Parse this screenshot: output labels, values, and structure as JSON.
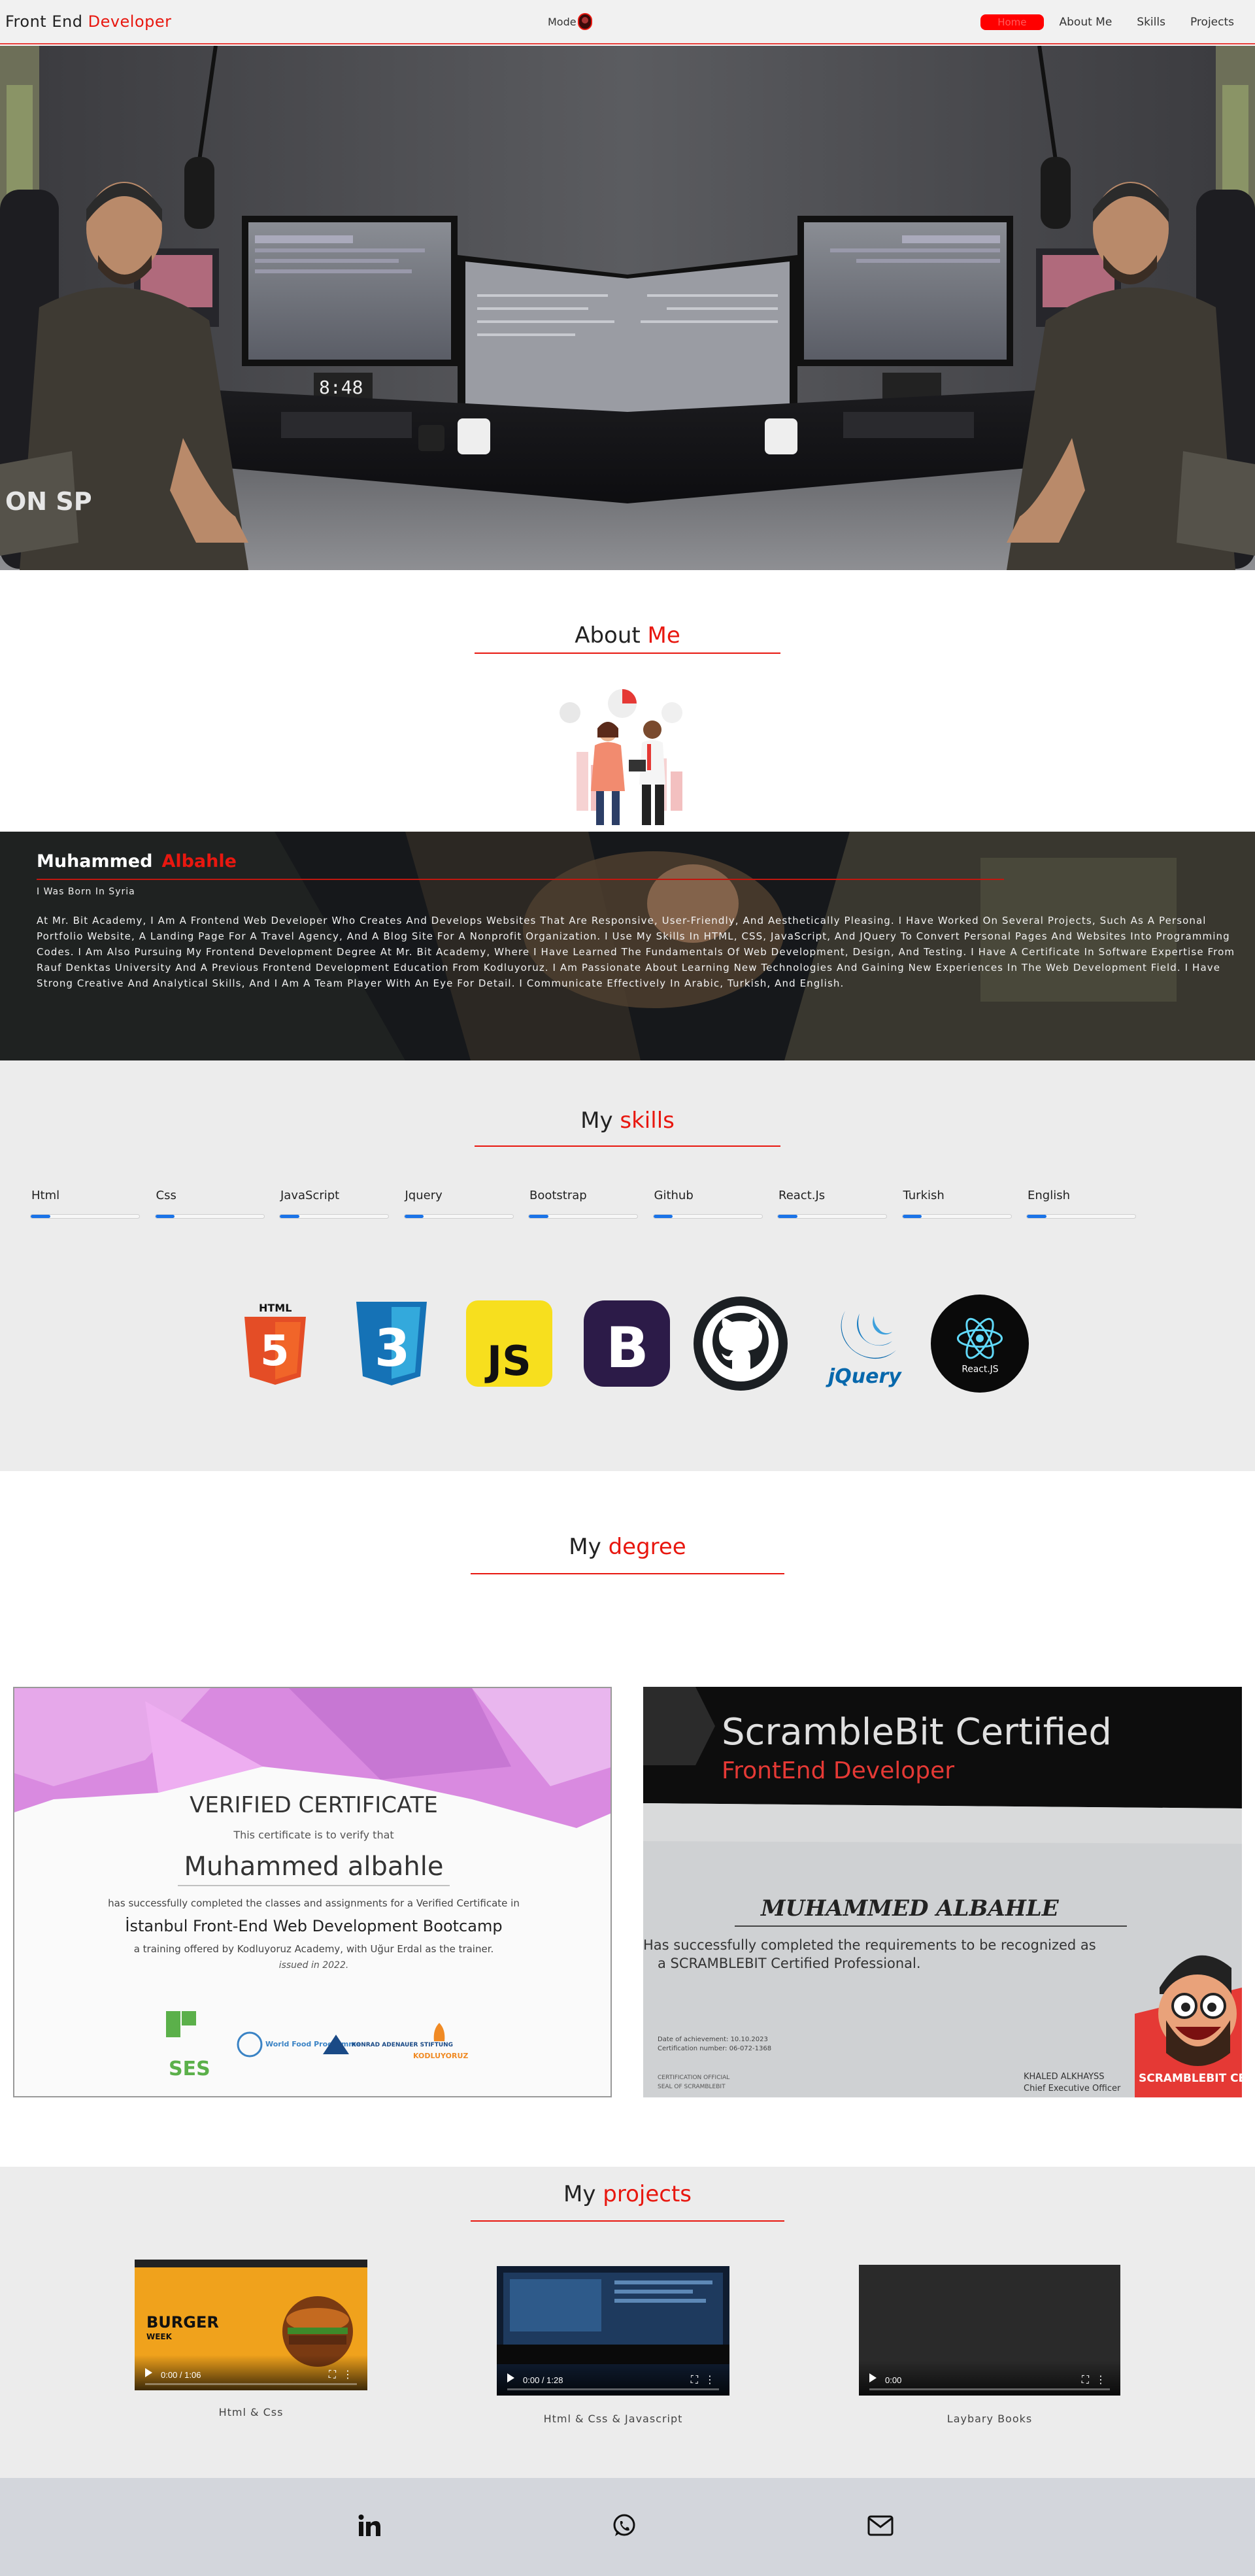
{
  "navbar": {
    "brand_plain": "Front End",
    "brand_accent": "Developer",
    "mode_label": "Mode",
    "links": [
      "Home",
      "About Me",
      "Skills",
      "Projects"
    ],
    "active_link": "Home"
  },
  "about": {
    "title_plain": "About",
    "title_accent": "Me",
    "first_name": "Muhammed",
    "last_name": "Albahle",
    "born": "I Was Born In Syria",
    "bio": "At Mr. Bit Academy, I Am A Frontend Web Developer Who Creates And Develops Websites That Are Responsive, User-Friendly, And Aesthetically Pleasing. I Have Worked On Several Projects, Such As A Personal Portfolio Website, A Landing Page For A Travel Agency, And A Blog Site For A Nonprofit Organization. I Use My Skills In HTML, CSS, JavaScript, And JQuery To Convert Personal Pages And Websites Into Programming Codes. I Am Also Pursuing My Frontend Development Degree At Mr. Bit Academy, Where I Have Learned The Fundamentals Of Web Development, Design, And Testing. I Have A Certificate In Software Expertise From Rauf Denktas University And A Previous Frontend Development Education From Kodluyoruz. I Am Passionate About Learning New Technologies And Gaining New Experiences In The Web Development Field. I Have Strong Creative And Analytical Skills, And I Am A Team Player With An Eye For Detail. I Communicate Effectively In Arabic, Turkish, And English."
  },
  "skills": {
    "title_plain": "My",
    "title_accent": "skills",
    "items": [
      {
        "label": "Html",
        "level": 0.18
      },
      {
        "label": "Css",
        "level": 0.18
      },
      {
        "label": "JavaScript",
        "level": 0.18
      },
      {
        "label": "Jquery",
        "level": 0.18
      },
      {
        "label": "Bootstrap",
        "level": 0.18
      },
      {
        "label": "Github",
        "level": 0.18
      },
      {
        "label": "React.Js",
        "level": 0.18
      },
      {
        "label": "Turkish",
        "level": 0.18
      },
      {
        "label": "English",
        "level": 0.18
      }
    ],
    "logos": {
      "html5": "HTML",
      "html5_num": "5",
      "css3_num": "3",
      "js": "JS",
      "bootstrap": "B",
      "jquery": "jQuery",
      "react": "React.JS"
    }
  },
  "degree": {
    "title_plain": "My",
    "title_accent": "degree",
    "cert1": {
      "heading": "VERIFIED CERTIFICATE",
      "verify": "This certificate is to verify that",
      "name": "Muhammed albahle",
      "line1": "has successfully completed the classes and assignments for a Verified Certificate in",
      "course": "İstanbul Front-End Web Development Bootcamp",
      "offered": "a training offered by Kodluyoruz Academy, with Uğur Erdal as the trainer.",
      "issued": "issued in 2022.",
      "sponsors": [
        "SES",
        "World Food Programme",
        "KONRAD ADENAUER STIFTUNG",
        "KODLUYORUZ"
      ]
    },
    "cert2": {
      "title": "ScrambleBit Certified",
      "subtitle": "FrontEnd Developer",
      "name": "MUHAMMED ALBAHLE",
      "line1": "Has successfully completed the requirements to be recognized as",
      "line2": "a SCRAMBLEBIT Certified Professional.",
      "date": "Date of achievement: 10.10.2023",
      "cert_no": "Certification number: 06-072-1368",
      "org1": "CERTIFICATION OFFICIAL",
      "org2": "SEAL OF SCRAMBLEBIT",
      "signer": "KHALED ALKHAYSS",
      "signer_title": "Chief Executive Officer",
      "badge": "SCRAMBLEBIT CERTIFIED"
    }
  },
  "projects": {
    "title_plain": "My",
    "title_accent": "projects",
    "items": [
      {
        "caption": "Html & Css",
        "time": "0:00 / 1:06",
        "thumb_title": "BURGER",
        "thumb_sub": "WEEK"
      },
      {
        "caption": "Html & Css & Javascript",
        "time": "0:00 / 1:28"
      },
      {
        "caption": "Laybary Books",
        "time": "0:00"
      }
    ]
  },
  "footer": {
    "icons": [
      "linkedin-icon",
      "whatsapp-icon",
      "email-icon"
    ]
  },
  "colors": {
    "accent": "#e8170f",
    "skill_bar": "#1a73e8",
    "navbar_bg": "#f1f1f1",
    "footer_bg": "#d3d6dc"
  }
}
